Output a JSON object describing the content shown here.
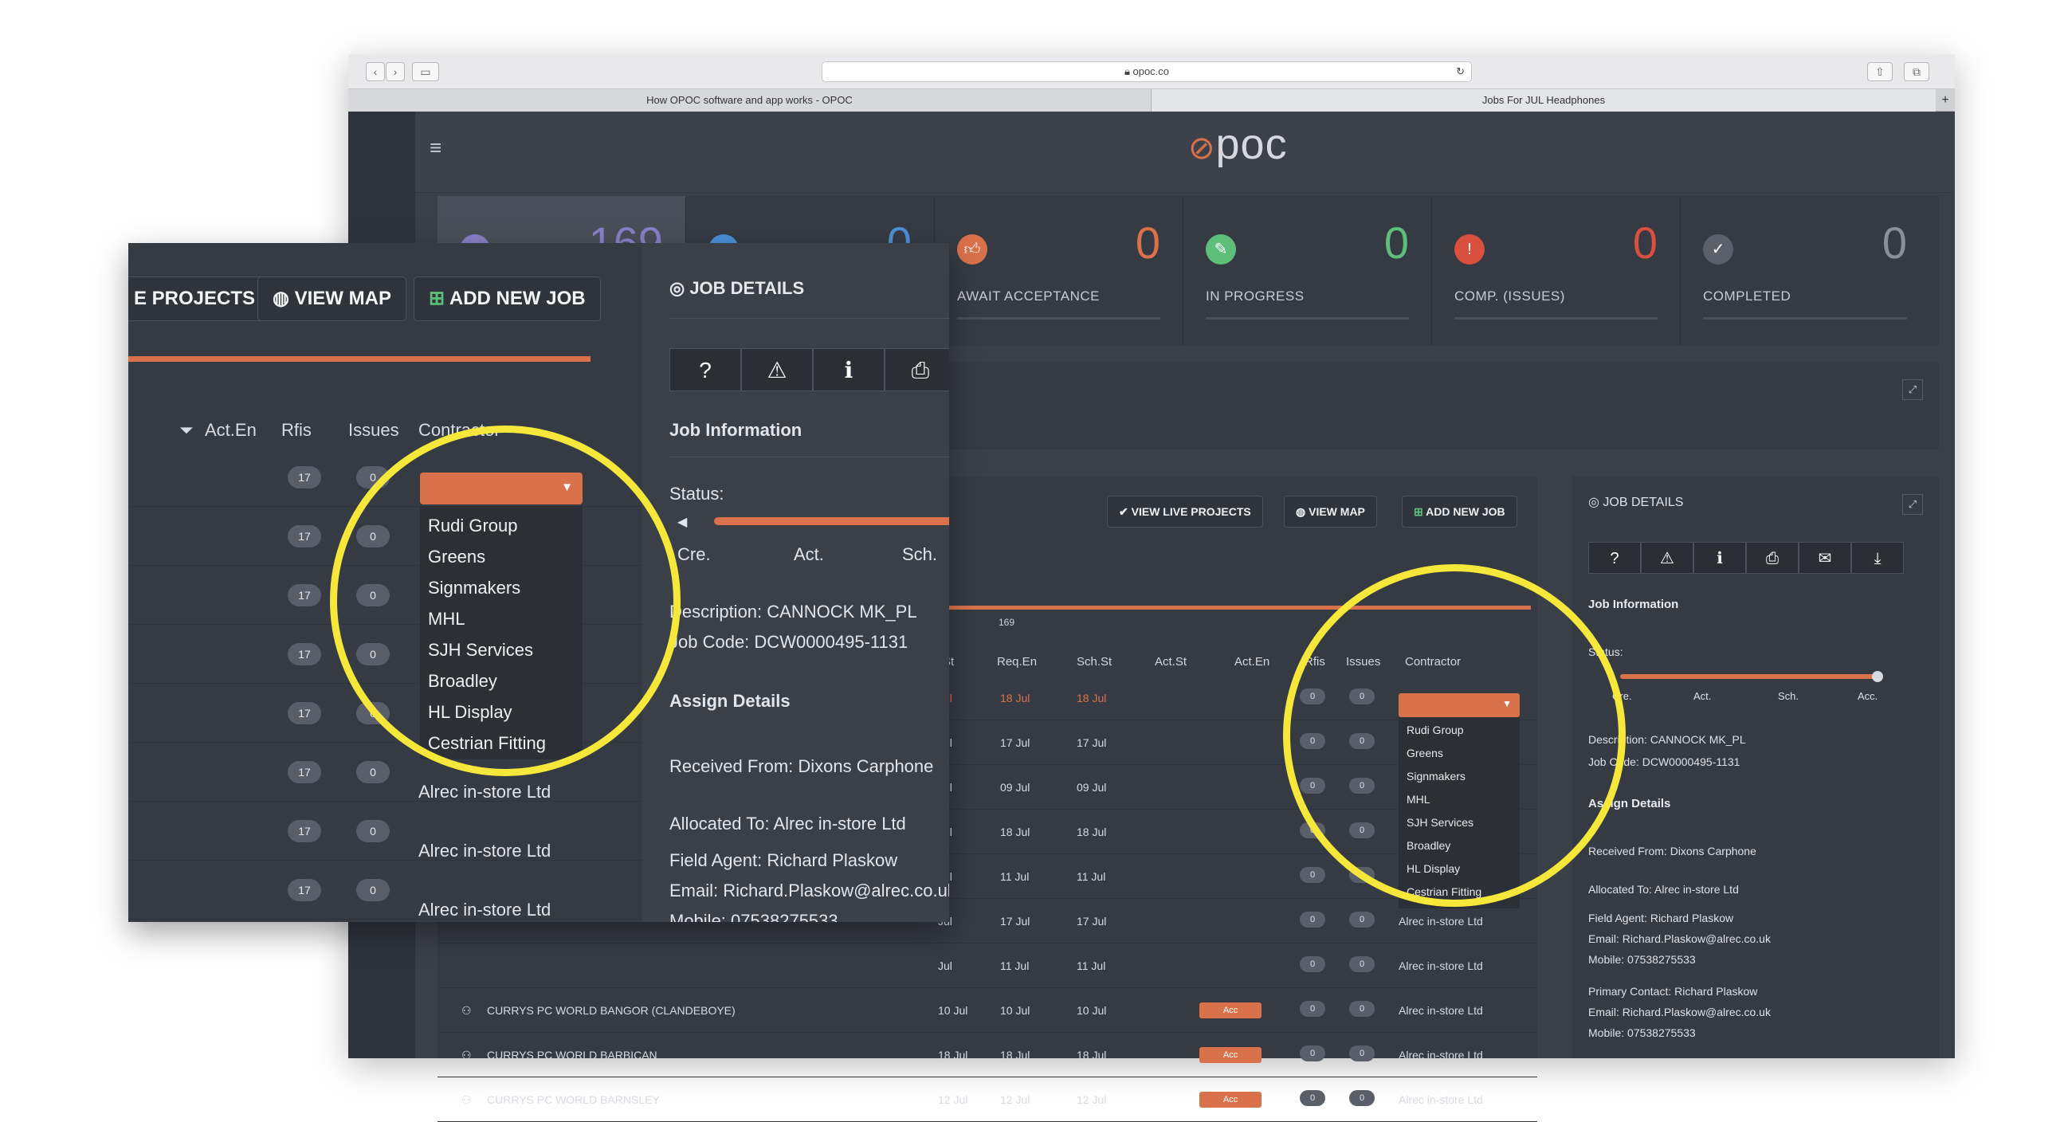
{
  "browser": {
    "url": "opoc.co",
    "tabs": [
      "How OPOC software and app works - OPOC",
      "Jobs For JUL Headphones"
    ]
  },
  "app": {
    "logo": "poc",
    "menu_icon": "hamburger-icon"
  },
  "stats": [
    {
      "value": "169",
      "label": "",
      "color": "#8a7fc7"
    },
    {
      "value": "0",
      "label": "",
      "color": "#4a90d9"
    },
    {
      "value": "0",
      "label": "AWAIT ACCEPTANCE",
      "color": "#d9714a"
    },
    {
      "value": "0",
      "label": "IN PROGRESS",
      "color": "#5dbf7a"
    },
    {
      "value": "0",
      "label": "COMP. (ISSUES)",
      "color": "#d9503f"
    },
    {
      "value": "0",
      "label": "COMPLETED",
      "color": "#8b8f99"
    }
  ],
  "toolbar": {
    "view_live_projects": "VIEW LIVE PROJECTS",
    "view_map": "VIEW MAP",
    "add_new_job": "ADD NEW JOB",
    "count": "169"
  },
  "table": {
    "columns": [
      "St",
      "Req.En",
      "Sch.St",
      "Act.St",
      "Act.En",
      "Rfis",
      "Issues",
      "Contractor"
    ],
    "rows": [
      {
        "name": "",
        "status": "",
        "d1": "Jul",
        "d2": "18 Jul",
        "d3": "18 Jul",
        "rfis": "0",
        "issues": "0",
        "contractor": ""
      },
      {
        "name": "",
        "status": "",
        "d1": "Jul",
        "d2": "17 Jul",
        "d3": "17 Jul",
        "rfis": "0",
        "issues": "0",
        "contractor": ""
      },
      {
        "name": "",
        "status": "",
        "d1": "Jul",
        "d2": "09 Jul",
        "d3": "09 Jul",
        "rfis": "0",
        "issues": "0",
        "contractor": ""
      },
      {
        "name": "",
        "status": "",
        "d1": "Jul",
        "d2": "18 Jul",
        "d3": "18 Jul",
        "rfis": "0",
        "issues": "0",
        "contractor": ""
      },
      {
        "name": "",
        "status": "",
        "d1": "Jul",
        "d2": "11 Jul",
        "d3": "11 Jul",
        "rfis": "0",
        "issues": "0",
        "contractor": ""
      },
      {
        "name": "",
        "status": "",
        "d1": "Jul",
        "d2": "17 Jul",
        "d3": "17 Jul",
        "rfis": "0",
        "issues": "0",
        "contractor": "Alrec in-store Ltd"
      },
      {
        "name": "",
        "status": "",
        "d1": "Jul",
        "d2": "11 Jul",
        "d3": "11 Jul",
        "rfis": "0",
        "issues": "0",
        "contractor": "Alrec in-store Ltd"
      },
      {
        "name": "CURRYS PC WORLD BANGOR (CLANDEBOYE)",
        "status": "Acc",
        "d1": "10 Jul",
        "d2": "10 Jul",
        "d3": "10 Jul",
        "rfis": "0",
        "issues": "0",
        "contractor": "Alrec in-store Ltd"
      },
      {
        "name": "CURRYS PC WORLD BARBICAN",
        "status": "Acc",
        "d1": "18 Jul",
        "d2": "18 Jul",
        "d3": "18 Jul",
        "rfis": "0",
        "issues": "0",
        "contractor": "Alrec in-store Ltd"
      },
      {
        "name": "CURRYS PC WORLD BARNSLEY",
        "status": "Acc",
        "d1": "12 Jul",
        "d2": "12 Jul",
        "d3": "12 Jul",
        "rfis": "0",
        "issues": "0",
        "contractor": "Alrec in-store Ltd"
      }
    ]
  },
  "contractor_dropdown": {
    "options": [
      "Rudi Group",
      "Greens",
      "Signmakers",
      "MHL",
      "SJH Services",
      "Broadley",
      "HL Display",
      "Cestrian Fitting"
    ]
  },
  "job_details": {
    "title": "JOB DETAILS",
    "job_information": "Job Information",
    "status_label": "Status:",
    "status_steps": [
      "Cre.",
      "Act.",
      "Sch.",
      "Acc."
    ],
    "description_label": "Description:",
    "description": "CANNOCK MK_PL",
    "job_code_label": "Job Code:",
    "job_code": "DCW0000495-1131",
    "assign_details": "Assign Details",
    "received_from_label": "Received From:",
    "received_from": "Dixons Carphone",
    "allocated_to_label": "Allocated To:",
    "allocated_to": "Alrec in-store Ltd",
    "field_agent_label": "Field Agent:",
    "field_agent": "Richard Plaskow",
    "email_label": "Email:",
    "email": "Richard.Plaskow@alrec.co.uk",
    "mobile_label": "Mobile:",
    "mobile": "07538275533",
    "primary_contact_label": "Primary Contact:",
    "primary_contact": "Richard Plaskow",
    "email2": "Richard.Plaskow@alrec.co.uk",
    "mobile2": "07538275533"
  },
  "zoom_left": {
    "buttons": [
      "E PROJECTS",
      "VIEW MAP",
      "ADD NEW JOB"
    ],
    "headers": [
      "Act.En",
      "Rfis",
      "Issues",
      "Contractor"
    ],
    "rfis": [
      "17",
      "17",
      "17",
      "17",
      "17",
      "17",
      "17",
      "17"
    ],
    "issues": [
      "0",
      "0",
      "0",
      "0",
      "0",
      "0",
      "0",
      "0"
    ],
    "contractors": [
      "Alrec in-store Ltd",
      "Alrec in-store Ltd",
      "Alrec in-store Ltd"
    ]
  }
}
